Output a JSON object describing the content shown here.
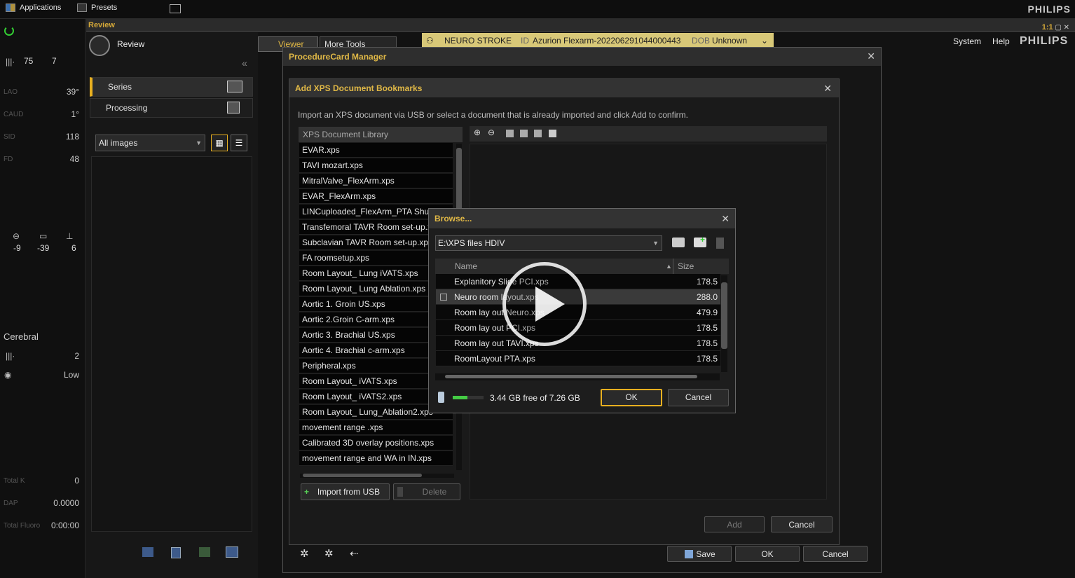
{
  "topbar": {
    "applications": "Applications",
    "presets": "Presets",
    "brand": "PHILIPS"
  },
  "left_stats": {
    "frame_rate": "75",
    "frame_rate2": "7",
    "lao_label": "LAO",
    "lao_val": "39°",
    "caud_label": "CAUD",
    "caud_val": "1°",
    "sid_label": "SID",
    "sid_val": "118",
    "fd_label": "FD",
    "fd_val": "48",
    "pos1": "-9",
    "pos2": "-39",
    "pos3": "6",
    "protocol": "Cerebral",
    "protocol_val": "2",
    "dose_level": "Low",
    "total_k_label": "Total K",
    "total_k_val": "0",
    "dap_label": "DAP",
    "dap_val": "0.0000",
    "fluoro_label": "Total Fluoro",
    "fluoro_val": "0:00:00"
  },
  "review": {
    "bar_label": "Review",
    "title": "Review",
    "series": "Series",
    "processing": "Processing",
    "filter": "All images"
  },
  "tabs": {
    "viewer": "Viewer",
    "more_tools": "More Tools"
  },
  "patient": {
    "name": "NEURO STROKE",
    "id_label": "ID",
    "id_val": "Azurion Flexarm-20220629104400044​3",
    "dob_label": "DOB",
    "dob_val": "Unknown"
  },
  "header_right": {
    "system": "System",
    "help": "Help",
    "brand": "PHILIPS",
    "small": "1:1"
  },
  "pcm": {
    "title": "ProcedureCard Manager",
    "save": "Save",
    "ok": "OK",
    "cancel": "Cancel"
  },
  "xps": {
    "title": "Add XPS Document Bookmarks",
    "instruction": "Import an XPS document via USB or select a document that is already imported and click Add to confirm.",
    "library_header": "XPS Document Library",
    "items": [
      "EVAR.xps",
      "TAVI mozart.xps",
      "MitralValve_FlexArm.xps",
      "EVAR_FlexArm.xps",
      "LINCuploaded_FlexArm_PTA Shunt.",
      "Transfemoral TAVR Room set-up.x",
      "Subclavian TAVR Room set-up.xps",
      "FA roomsetup.xps",
      "Room Layout_ Lung iVATS.xps",
      "Room Layout_ Lung Ablation.xps",
      "Aortic 1. Groin US.xps",
      "Aortic 2.Groin C-arm.xps",
      "Aortic 3. Brachial US.xps",
      "Aortic 4. Brachial c-arm.xps",
      "Peripheral.xps",
      "Room Layout_ iVATS.xps",
      "Room Layout_ iVATS2.xps",
      "Room Layout_ Lung_Ablation2.xps",
      "movement range .xps",
      "Calibrated 3D overlay positions.xps",
      "movement range and WA in IN.xps"
    ],
    "import_usb": "Import from USB",
    "delete": "Delete",
    "add": "Add",
    "cancel": "Cancel"
  },
  "browse": {
    "title": "Browse...",
    "path": "E:\\XPS files HDIV",
    "col_name": "Name",
    "col_size": "Size",
    "files": [
      {
        "name": "Explanitory Slide PCI.xps",
        "size": "178.5"
      },
      {
        "name": "Neuro room layout.xps",
        "size": "288.0"
      },
      {
        "name": "Room lay out Neuro.xps",
        "size": "479.9"
      },
      {
        "name": "Room lay out PCI.xps",
        "size": "178.5"
      },
      {
        "name": "Room lay out TAVI.xps",
        "size": "178.5"
      },
      {
        "name": "RoomLayout PTA.xps",
        "size": "178.5"
      }
    ],
    "free_space": "3.44 GB free of 7.26 GB",
    "free_fraction": 0.47,
    "ok": "OK",
    "cancel": "Cancel"
  }
}
